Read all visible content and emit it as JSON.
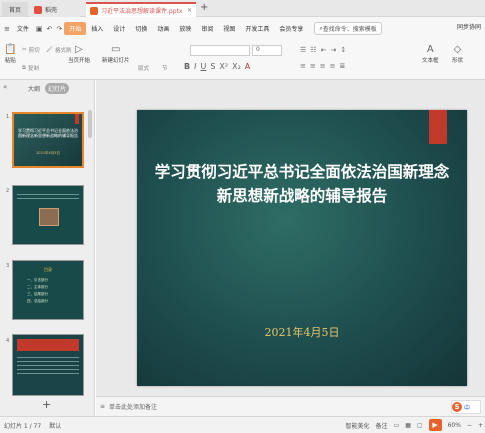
{
  "tabs": {
    "home": "首页",
    "draft": "稻壳",
    "doc": "习近平法治思想解读课件.pptx"
  },
  "menu": {
    "file": "文件",
    "items": [
      "开始",
      "插入",
      "设计",
      "切换",
      "动画",
      "放映",
      "审阅",
      "视图",
      "开发工具",
      "会员专享"
    ],
    "search": "查找命令、搜索模板",
    "sync": "同步协同",
    "share": "分享"
  },
  "ribbon": {
    "paste": "粘贴",
    "cut": "剪切",
    "copy": "复制",
    "format_painter": "格式刷",
    "play": "当页开始",
    "new_slide": "新建幻灯片",
    "layout": "版式",
    "section": "节",
    "font_size": "0",
    "textbox": "文本框",
    "shape": "形状"
  },
  "panel": {
    "outline": "大纲",
    "slides": "幻灯片",
    "thumbs": [
      {
        "num": "1",
        "title": "学习贯彻习近平总书记全面依法治国新理念新思想新战略的辅导报告",
        "date": "2021年4月5日"
      },
      {
        "num": "2"
      },
      {
        "num": "3",
        "heading": "目录",
        "toc": [
          "一、引言部分",
          "二、主体部分",
          "三、结尾部分",
          "四、总结部分"
        ]
      },
      {
        "num": "4"
      }
    ]
  },
  "slide": {
    "title_line1": "学习贯彻习近平总书记全面依法治国新理念",
    "title_line2": "新思想新战略的辅导报告",
    "date": "2021年4月5日"
  },
  "notes": {
    "placeholder": "单击此处添加备注"
  },
  "status": {
    "slide_count": "幻灯片 1 / 77",
    "theme": "默认",
    "smart_beautify": "智能美化",
    "notes": "备注",
    "zoom": "60%"
  },
  "colors": {
    "accent": "#e8862c",
    "slide_bg": "#1e4d4d",
    "red_accent": "#c0392b",
    "date_gold": "#e8c66a"
  }
}
